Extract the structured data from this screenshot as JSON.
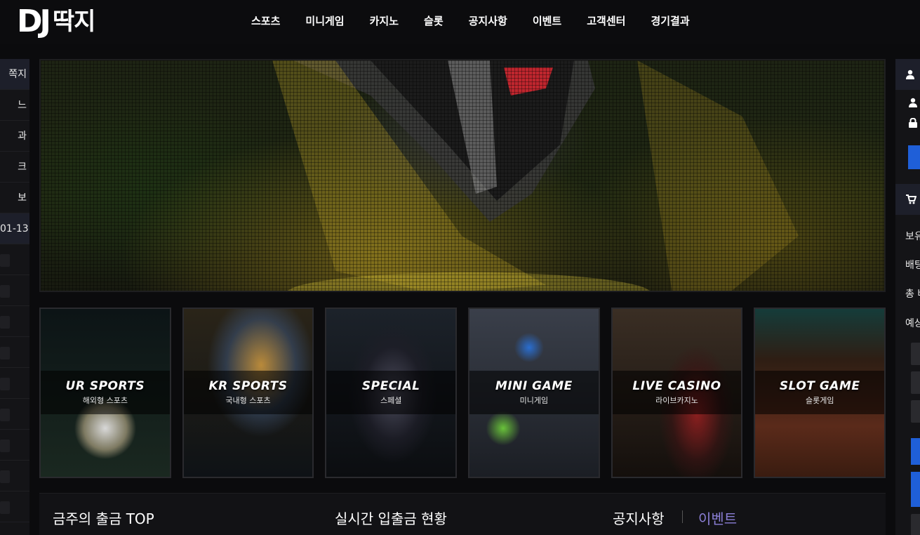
{
  "logo": {
    "dj": "DJ",
    "kr": "딱지"
  },
  "nav": [
    "스포츠",
    "미니게임",
    "카지노",
    "슬롯",
    "공지사항",
    "이벤트",
    "고객센터",
    "경기결과"
  ],
  "left_sidebar": {
    "items": [
      "쪽지",
      "느",
      "과",
      "크",
      "보",
      "01-13"
    ]
  },
  "cards": [
    {
      "en": "UR SPORTS",
      "ko": "해외형 스포츠"
    },
    {
      "en": "KR SPORTS",
      "ko": "국내형 스포츠"
    },
    {
      "en": "SPECIAL",
      "ko": "스페셜"
    },
    {
      "en": "MINI GAME",
      "ko": "미니게임"
    },
    {
      "en": "LIVE CASINO",
      "ko": "라이브카지노"
    },
    {
      "en": "SLOT GAME",
      "ko": "슬롯게임"
    }
  ],
  "bottom": {
    "withdraw_top": "금주의 출금 TOP",
    "realtime": "실시간 입출금 현황",
    "tab_notice": "공지사항",
    "tab_event": "이벤트"
  },
  "right_sidebar": {
    "labels": [
      "보유",
      "배팅",
      "총 바",
      "예상"
    ]
  },
  "colors": {
    "accent_blue": "#1f5fd8",
    "event_tab": "#8b7fd6",
    "background": "#0b0b0d"
  }
}
